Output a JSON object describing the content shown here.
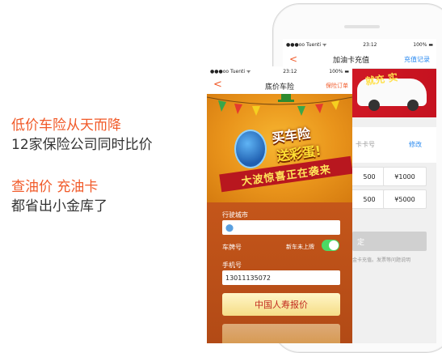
{
  "promo": {
    "line1": "低价车险从天而降",
    "line2": "12家保险公司同时比价",
    "line3": "查油价  充油卡",
    "line4": "都省出小金库了"
  },
  "back_phone": {
    "status": {
      "carrier": "●●●oo Tuenti ᯤ",
      "time": "23:12",
      "battery": "100% ▬"
    },
    "nav": {
      "back": "<",
      "title": "加油卡充值",
      "records": "充值记录"
    },
    "banner": {
      "slogan": "就充 实"
    },
    "card_hint": "卡卡号",
    "edit": "修改",
    "amounts": [
      "500",
      "¥1000",
      "500",
      "¥5000"
    ],
    "confirm": "定",
    "fine_print": "金卡充值。发票等问题说明"
  },
  "front_phone": {
    "status": {
      "carrier": "●●●oo Tuenti ᯤ",
      "time": "23:12",
      "battery": "100% ▬"
    },
    "nav": {
      "back": "<",
      "title": "底价车险",
      "order": "保险订单"
    },
    "hero": {
      "line1": "买车险",
      "line2": "送彩蛋!",
      "ribbon": "大波惊喜正在袭来"
    },
    "form": {
      "city_label": "行驶城市",
      "city_value": "",
      "plate_label": "车牌号",
      "new_car_label": "新车未上牌",
      "new_car_toggle": true,
      "phone_label": "手机号",
      "phone_value": "13011135072",
      "quote_button": "中国人寿报价"
    }
  },
  "colors": {
    "accent": "#f15a29",
    "link": "#2a8af0",
    "toggle_on": "#4cd964"
  }
}
